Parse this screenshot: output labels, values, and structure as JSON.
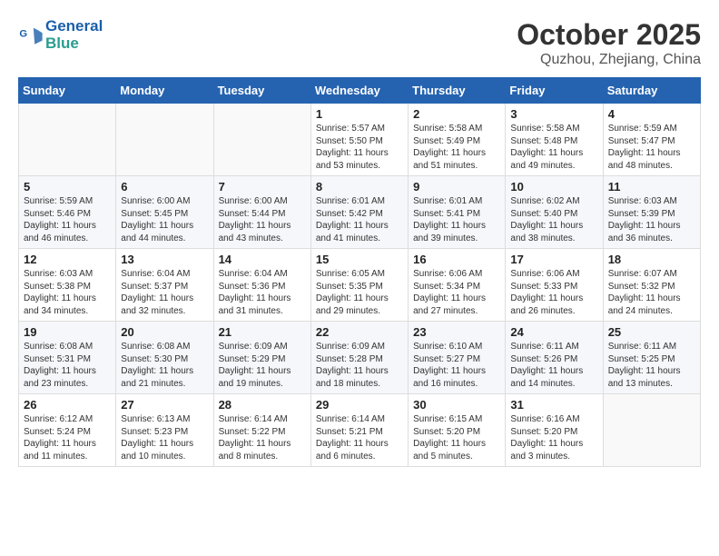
{
  "logo": {
    "line1": "General",
    "line2": "Blue"
  },
  "title": "October 2025",
  "subtitle": "Quzhou, Zhejiang, China",
  "weekdays": [
    "Sunday",
    "Monday",
    "Tuesday",
    "Wednesday",
    "Thursday",
    "Friday",
    "Saturday"
  ],
  "weeks": [
    [
      {
        "day": "",
        "info": ""
      },
      {
        "day": "",
        "info": ""
      },
      {
        "day": "",
        "info": ""
      },
      {
        "day": "1",
        "info": "Sunrise: 5:57 AM\nSunset: 5:50 PM\nDaylight: 11 hours and 53 minutes."
      },
      {
        "day": "2",
        "info": "Sunrise: 5:58 AM\nSunset: 5:49 PM\nDaylight: 11 hours and 51 minutes."
      },
      {
        "day": "3",
        "info": "Sunrise: 5:58 AM\nSunset: 5:48 PM\nDaylight: 11 hours and 49 minutes."
      },
      {
        "day": "4",
        "info": "Sunrise: 5:59 AM\nSunset: 5:47 PM\nDaylight: 11 hours and 48 minutes."
      }
    ],
    [
      {
        "day": "5",
        "info": "Sunrise: 5:59 AM\nSunset: 5:46 PM\nDaylight: 11 hours and 46 minutes."
      },
      {
        "day": "6",
        "info": "Sunrise: 6:00 AM\nSunset: 5:45 PM\nDaylight: 11 hours and 44 minutes."
      },
      {
        "day": "7",
        "info": "Sunrise: 6:00 AM\nSunset: 5:44 PM\nDaylight: 11 hours and 43 minutes."
      },
      {
        "day": "8",
        "info": "Sunrise: 6:01 AM\nSunset: 5:42 PM\nDaylight: 11 hours and 41 minutes."
      },
      {
        "day": "9",
        "info": "Sunrise: 6:01 AM\nSunset: 5:41 PM\nDaylight: 11 hours and 39 minutes."
      },
      {
        "day": "10",
        "info": "Sunrise: 6:02 AM\nSunset: 5:40 PM\nDaylight: 11 hours and 38 minutes."
      },
      {
        "day": "11",
        "info": "Sunrise: 6:03 AM\nSunset: 5:39 PM\nDaylight: 11 hours and 36 minutes."
      }
    ],
    [
      {
        "day": "12",
        "info": "Sunrise: 6:03 AM\nSunset: 5:38 PM\nDaylight: 11 hours and 34 minutes."
      },
      {
        "day": "13",
        "info": "Sunrise: 6:04 AM\nSunset: 5:37 PM\nDaylight: 11 hours and 32 minutes."
      },
      {
        "day": "14",
        "info": "Sunrise: 6:04 AM\nSunset: 5:36 PM\nDaylight: 11 hours and 31 minutes."
      },
      {
        "day": "15",
        "info": "Sunrise: 6:05 AM\nSunset: 5:35 PM\nDaylight: 11 hours and 29 minutes."
      },
      {
        "day": "16",
        "info": "Sunrise: 6:06 AM\nSunset: 5:34 PM\nDaylight: 11 hours and 27 minutes."
      },
      {
        "day": "17",
        "info": "Sunrise: 6:06 AM\nSunset: 5:33 PM\nDaylight: 11 hours and 26 minutes."
      },
      {
        "day": "18",
        "info": "Sunrise: 6:07 AM\nSunset: 5:32 PM\nDaylight: 11 hours and 24 minutes."
      }
    ],
    [
      {
        "day": "19",
        "info": "Sunrise: 6:08 AM\nSunset: 5:31 PM\nDaylight: 11 hours and 23 minutes."
      },
      {
        "day": "20",
        "info": "Sunrise: 6:08 AM\nSunset: 5:30 PM\nDaylight: 11 hours and 21 minutes."
      },
      {
        "day": "21",
        "info": "Sunrise: 6:09 AM\nSunset: 5:29 PM\nDaylight: 11 hours and 19 minutes."
      },
      {
        "day": "22",
        "info": "Sunrise: 6:09 AM\nSunset: 5:28 PM\nDaylight: 11 hours and 18 minutes."
      },
      {
        "day": "23",
        "info": "Sunrise: 6:10 AM\nSunset: 5:27 PM\nDaylight: 11 hours and 16 minutes."
      },
      {
        "day": "24",
        "info": "Sunrise: 6:11 AM\nSunset: 5:26 PM\nDaylight: 11 hours and 14 minutes."
      },
      {
        "day": "25",
        "info": "Sunrise: 6:11 AM\nSunset: 5:25 PM\nDaylight: 11 hours and 13 minutes."
      }
    ],
    [
      {
        "day": "26",
        "info": "Sunrise: 6:12 AM\nSunset: 5:24 PM\nDaylight: 11 hours and 11 minutes."
      },
      {
        "day": "27",
        "info": "Sunrise: 6:13 AM\nSunset: 5:23 PM\nDaylight: 11 hours and 10 minutes."
      },
      {
        "day": "28",
        "info": "Sunrise: 6:14 AM\nSunset: 5:22 PM\nDaylight: 11 hours and 8 minutes."
      },
      {
        "day": "29",
        "info": "Sunrise: 6:14 AM\nSunset: 5:21 PM\nDaylight: 11 hours and 6 minutes."
      },
      {
        "day": "30",
        "info": "Sunrise: 6:15 AM\nSunset: 5:20 PM\nDaylight: 11 hours and 5 minutes."
      },
      {
        "day": "31",
        "info": "Sunrise: 6:16 AM\nSunset: 5:20 PM\nDaylight: 11 hours and 3 minutes."
      },
      {
        "day": "",
        "info": ""
      }
    ]
  ]
}
